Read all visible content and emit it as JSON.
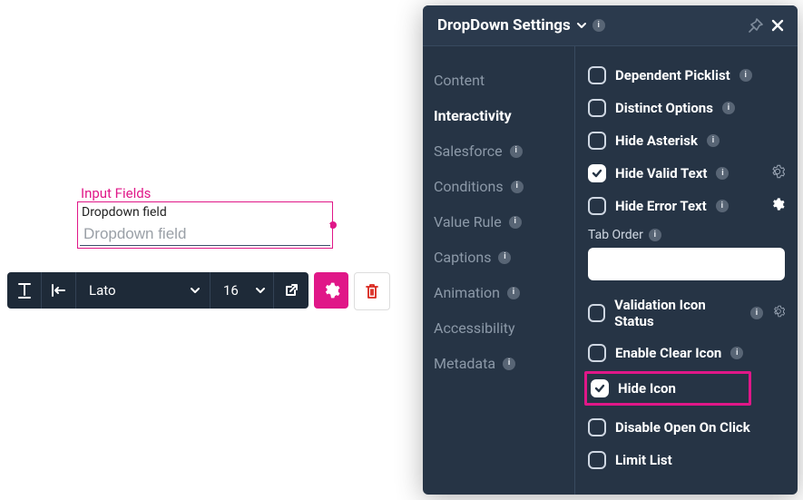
{
  "canvas": {
    "group_label": "Input Fields",
    "field_title": "Dropdown field",
    "field_placeholder": "Dropdown field"
  },
  "toolbar": {
    "font_name": "Lato",
    "font_size": "16"
  },
  "panel": {
    "title": "DropDown Settings",
    "nav": {
      "content": "Content",
      "interactivity": "Interactivity",
      "salesforce": "Salesforce",
      "conditions": "Conditions",
      "value_rule": "Value Rule",
      "captions": "Captions",
      "animation": "Animation",
      "accessibility": "Accessibility",
      "metadata": "Metadata"
    },
    "options": {
      "dependent_picklist": "Dependent Picklist",
      "distinct_options": "Distinct Options",
      "hide_asterisk": "Hide Asterisk",
      "hide_valid_text": "Hide Valid Text",
      "hide_error_text": "Hide Error Text",
      "tab_order_label": "Tab Order",
      "tab_order_value": "",
      "validation_icon_status": "Validation Icon Status",
      "enable_clear_icon": "Enable Clear Icon",
      "hide_icon": "Hide Icon",
      "disable_open_on_click": "Disable Open On Click",
      "limit_list": "Limit List"
    }
  }
}
